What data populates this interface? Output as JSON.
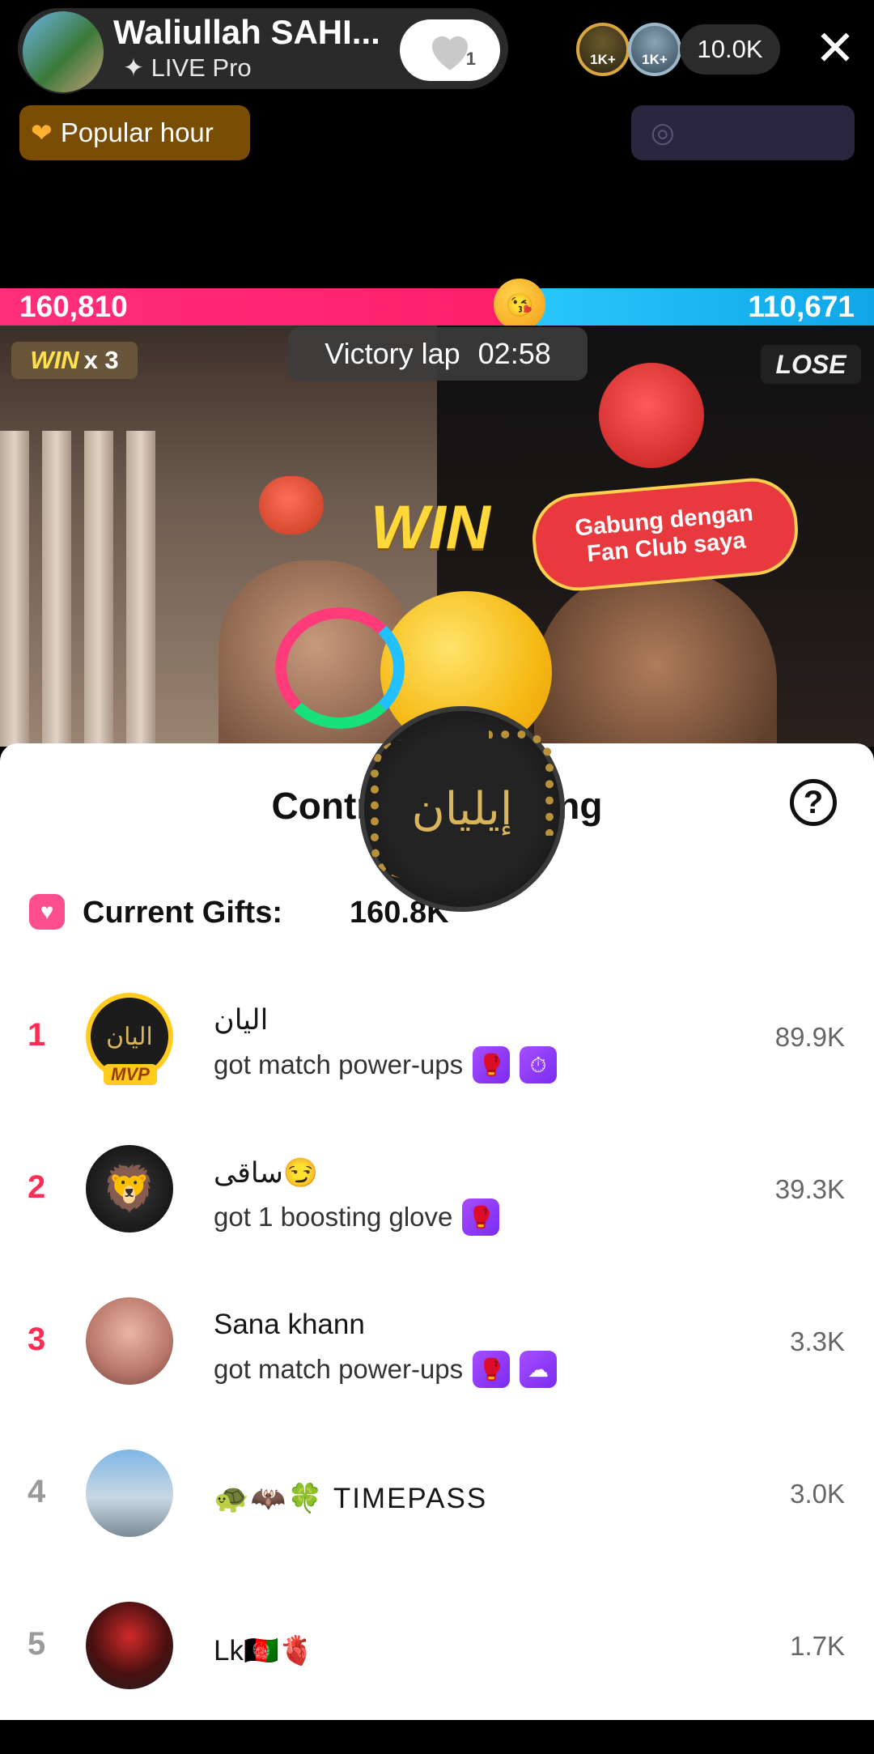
{
  "header": {
    "host_name": "Waliullah SAHI...",
    "host_sub": "✦ LIVE Pro",
    "follow_count": "1",
    "badge1": "1K+",
    "badge2": "1K+",
    "viewers": "10.0K",
    "close": "✕",
    "popular_label": "Popular hour"
  },
  "battle": {
    "left_score": "160,810",
    "right_score": "110,671",
    "win_label": "WIN",
    "win_multiplier": "x 3",
    "lose_label": "LOSE",
    "victory_text": "Victory lap",
    "victory_timer": "02:58",
    "big_win": "WIN",
    "fan_club_line1": "Gabung dengan",
    "fan_club_line2": "Fan Club saya",
    "accent_left": "#ff2f7a",
    "accent_right": "#2bc9ff"
  },
  "sheet": {
    "title": "Contribution ranking",
    "title_visible": "Contri                 ng",
    "help": "?",
    "overlay_text": "إيليان",
    "current_gifts_label": "Current Gifts:",
    "current_gifts_value": "160.8K"
  },
  "ranking": [
    {
      "rank": "1",
      "name": "اليان",
      "desc": "got match power-ups",
      "score": "89.9K",
      "badge": "MVP",
      "avatar_text": "اليان",
      "rank_color": "#ff2d55"
    },
    {
      "rank": "2",
      "name": "ساقی😏",
      "desc": "got 1 boosting glove",
      "score": "39.3K",
      "avatar_text": "🦁",
      "rank_color": "#ff2d55"
    },
    {
      "rank": "3",
      "name": "Sana khann",
      "desc": "got match power-ups",
      "score": "3.3K",
      "avatar_text": "",
      "rank_color": "#ff2d55"
    },
    {
      "rank": "4",
      "name": "🐢🦇🍀 TIMEPASS",
      "desc": "",
      "score": "3.0K",
      "avatar_text": "",
      "rank_color": "#9a9a9a"
    },
    {
      "rank": "5",
      "name": "Lk🇦🇫🫀",
      "desc": "",
      "score": "1.7K",
      "avatar_text": "",
      "rank_color": "#9a9a9a"
    }
  ]
}
